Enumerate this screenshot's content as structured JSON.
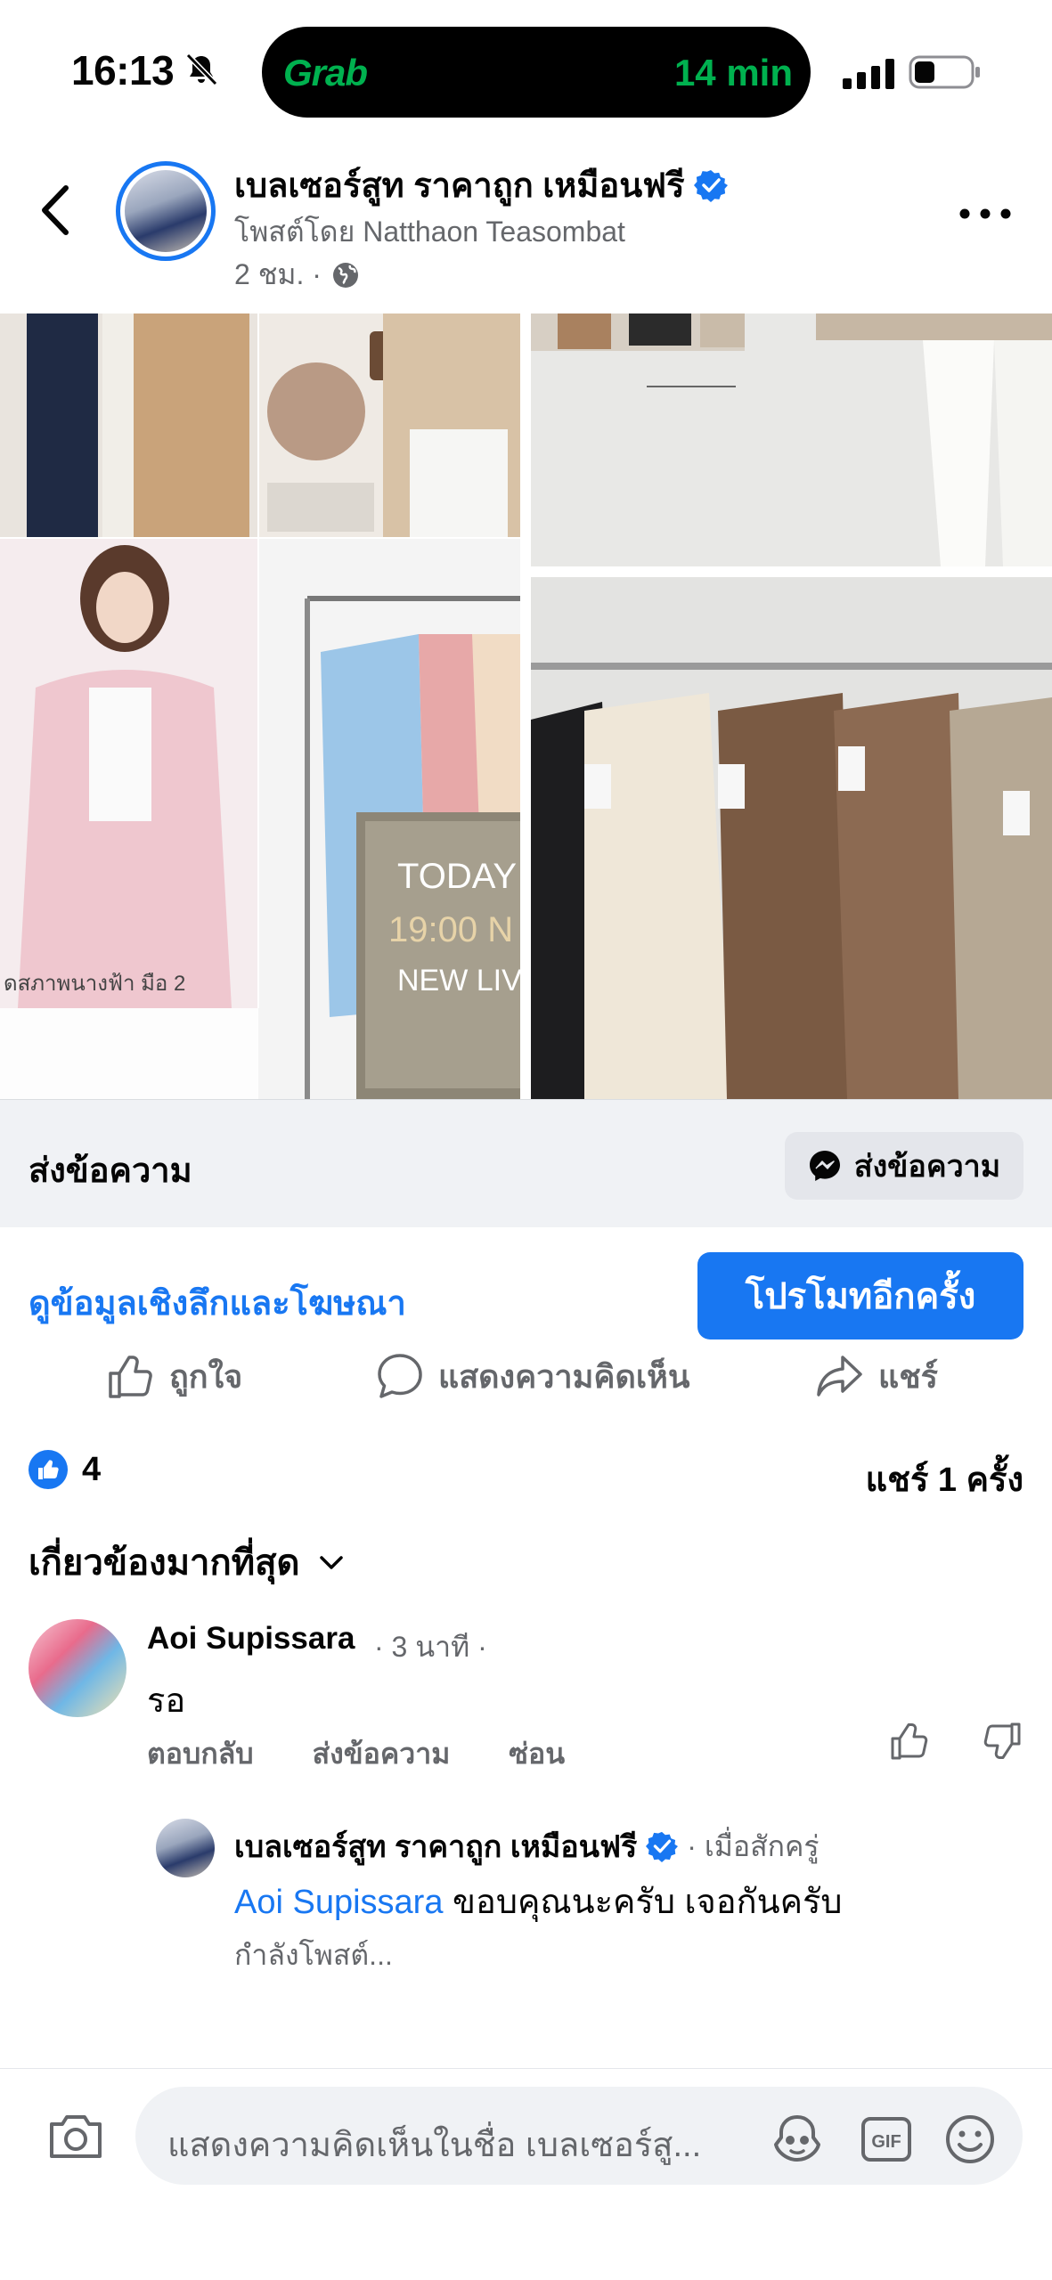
{
  "status_bar": {
    "time": "16:13",
    "island_brand": "Grab",
    "island_eta": "14 min",
    "icons": [
      "bell-slash-icon",
      "signal-icon",
      "battery-icon"
    ]
  },
  "post": {
    "page_name": "เบลเซอร์สูท ราคาถูก เหมือนฟรี",
    "posted_by": "โพสต์โดย Natthaon Teasombat",
    "time": "2 ชม. ·",
    "photos": {
      "overlay_today": "TODAY",
      "overlay_time": "19:00 N",
      "overlay_live": "NEW LIV",
      "overlay_caption": "ดสภาพนางฟ้า มือ 2"
    }
  },
  "message_bar": {
    "label": "ส่งข้อความ",
    "button": "ส่งข้อความ"
  },
  "insights": {
    "link": "ดูข้อมูลเชิงลึกและโฆษณา",
    "promote_button": "โปรโมทอีกครั้ง"
  },
  "actions": {
    "like": "ถูกใจ",
    "comment": "แสดงความคิดเห็น",
    "share": "แชร์"
  },
  "reactions": {
    "count": "4",
    "shares": "แชร์ 1 ครั้ง"
  },
  "sort": {
    "label": "เกี่ยวข้องมากที่สุด"
  },
  "comment": {
    "author": "Aoi Supissara",
    "meta": "· 3 นาที ·",
    "text": "รอ",
    "reply": "ตอบกลับ",
    "message": "ส่งข้อความ",
    "hide": "ซ่อน"
  },
  "reply": {
    "author": "เบลเซอร์สูท ราคาถูก เหมือนฟรี",
    "meta": "· เมื่อสักครู่",
    "mention": "Aoi Supissara",
    "text": " ขอบคุณนะครับ เจอกันครับ",
    "status": "กำลังโพสต์..."
  },
  "composer": {
    "placeholder": "แสดงความคิดเห็นในชื่อ เบลเซอร์สู..."
  },
  "colors": {
    "accent": "#1877f2",
    "grab_green": "#00b14f",
    "secondary_text": "#65676b",
    "bar_bg": "#f0f2f5"
  }
}
